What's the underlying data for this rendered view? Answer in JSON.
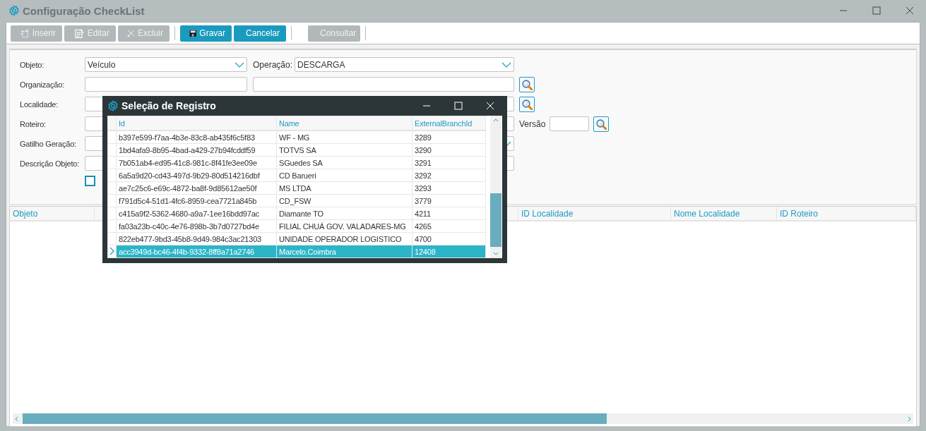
{
  "window": {
    "title": "Configuração CheckList"
  },
  "toolbar": [
    {
      "kind": "button",
      "label": "Inserir",
      "disabled": true
    },
    {
      "kind": "button",
      "label": "Editar",
      "disabled": true
    },
    {
      "kind": "button",
      "label": "Excluir",
      "disabled": true
    },
    {
      "kind": "separator"
    },
    {
      "kind": "button",
      "label": "Gravar",
      "disabled": false
    },
    {
      "kind": "button",
      "label": "Cancelar",
      "disabled": false
    },
    {
      "kind": "separator"
    },
    {
      "kind": "button",
      "label": "Consultar",
      "disabled": true
    },
    {
      "kind": "separator"
    }
  ],
  "form": {
    "rows": [
      {
        "label": "Objeto:",
        "fields": [
          {
            "kind": "dropdown",
            "value": "Veículo"
          },
          {
            "kind": "label",
            "text": "Operação:"
          },
          {
            "kind": "dropdown",
            "value": "DESCARGA"
          }
        ]
      },
      {
        "label": "Organização:",
        "fields": [
          {
            "kind": "text"
          },
          {
            "kind": "text"
          }
        ],
        "trailing": [
          {
            "kind": "search"
          }
        ]
      },
      {
        "label": "Localidade:",
        "fields": [
          {
            "kind": "text"
          },
          {
            "kind": "text"
          }
        ],
        "trailing": [
          {
            "kind": "search"
          }
        ]
      },
      {
        "label": "Roteiro:",
        "fields": [
          {
            "kind": "text"
          },
          {
            "kind": "text"
          }
        ],
        "trailing": [
          {
            "kind": "label",
            "text": "Versão"
          },
          {
            "kind": "text"
          },
          {
            "kind": "search"
          }
        ]
      },
      {
        "label": "Gatilho Geração:",
        "fields": [
          {
            "kind": "dropdown"
          }
        ]
      },
      {
        "label": "Descrição Objeto:",
        "fields": [
          {
            "kind": "text"
          }
        ]
      }
    ],
    "checkbox": {
      "checked": false
    }
  },
  "grid": {
    "columns": [
      "Objeto",
      "ID Localidade",
      "Nome Localidade",
      "ID Roteiro"
    ]
  },
  "dialog": {
    "title": "Seleção de Registro",
    "columns": [
      "Id",
      "Name",
      "ExternalBranchId"
    ],
    "rows": [
      {
        "id": "b397e599-f7aa-4b3e-83c8-ab435f6c5f83",
        "name": "WF - MG",
        "external_branch_id": "3289",
        "selected": false
      },
      {
        "id": "1bd4afa9-8b95-4bad-a429-27b94fcddf59",
        "name": "TOTVS SA",
        "external_branch_id": "3290",
        "selected": false
      },
      {
        "id": "7b051ab4-ed95-41c8-981c-8f41fe3ee09e",
        "name": "SGuedes SA",
        "external_branch_id": "3291",
        "selected": false
      },
      {
        "id": "6a5a9d20-cd43-497d-9b29-80d514216dbf",
        "name": "CD Barueri",
        "external_branch_id": "3292",
        "selected": false
      },
      {
        "id": "ae7c25c6-e69c-4872-ba8f-9d85612ae50f",
        "name": "MS LTDA",
        "external_branch_id": "3293",
        "selected": false
      },
      {
        "id": "f791d5c4-51d1-4fc6-8959-cea7721a845b",
        "name": "CD_FSW",
        "external_branch_id": "3779",
        "selected": false
      },
      {
        "id": "c415a9f2-5362-4680-a9a7-1ee16bdd97ac",
        "name": "Diamante TO",
        "external_branch_id": "4211",
        "selected": false
      },
      {
        "id": "fa03a23b-c40c-4e76-898b-3b7d0727bd4e",
        "name": "FILIAL CHUÁ GOV. VALADARES-MG",
        "external_branch_id": "4265",
        "selected": false
      },
      {
        "id": "822eb477-9bd3-45b8-9d49-984c3ac21303",
        "name": "UNIDADE OPERADOR LOGISTICO",
        "external_branch_id": "4700",
        "selected": false
      },
      {
        "id": "acc3949d-bc46-4f4b-9332-8ff8a71a2746",
        "name": "Marcelo.Coimbra",
        "external_branch_id": "12408",
        "selected": true
      }
    ]
  }
}
